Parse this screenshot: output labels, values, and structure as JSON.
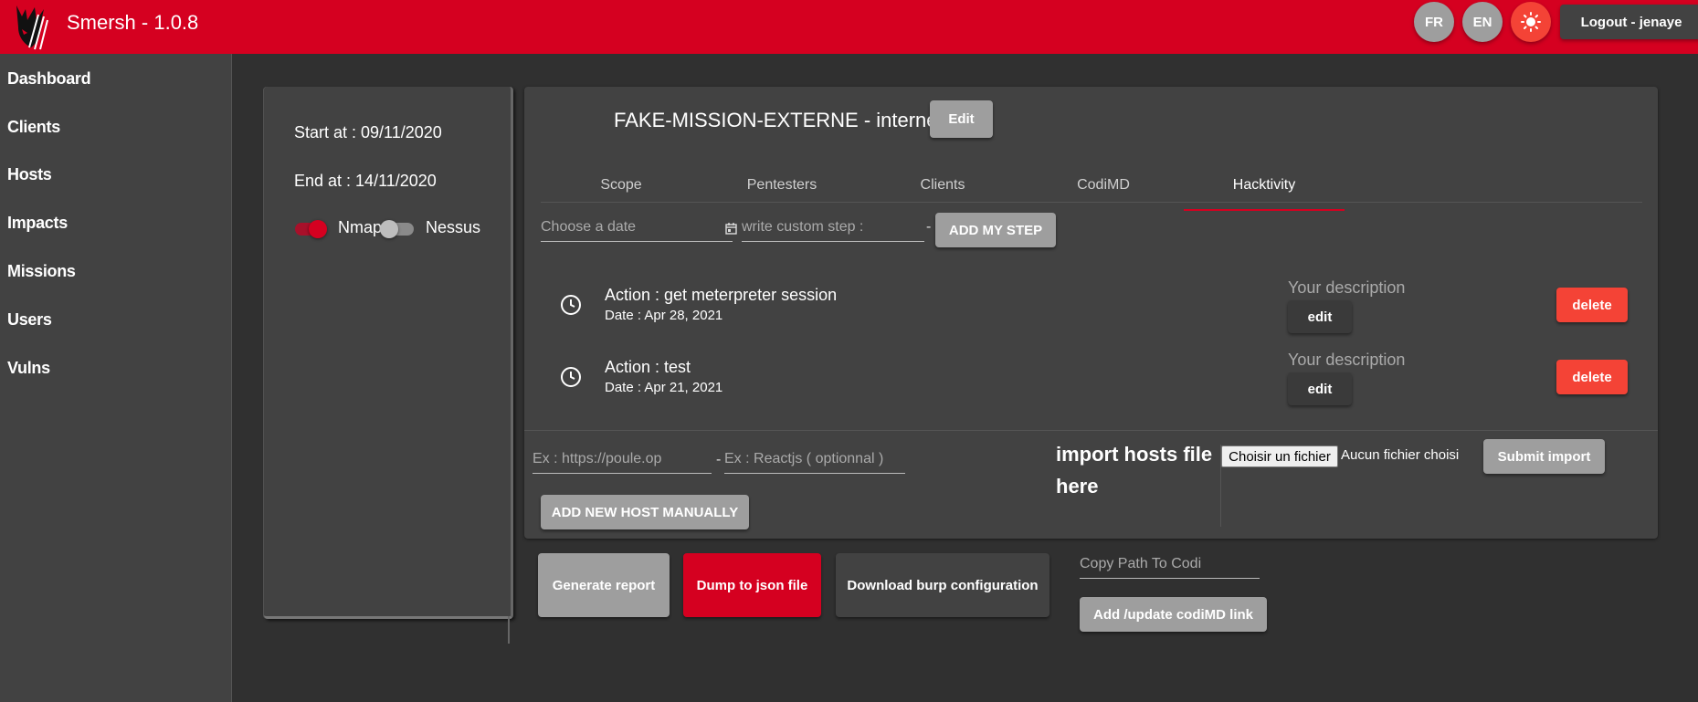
{
  "header": {
    "title": "Smersh - 1.0.8",
    "lang_fr": "FR",
    "lang_en": "EN",
    "theme_icon": "sun-icon",
    "logout_label": "Logout - jenaye"
  },
  "sidebar": {
    "items": [
      {
        "label": "Dashboard"
      },
      {
        "label": "Clients"
      },
      {
        "label": "Hosts"
      },
      {
        "label": "Impacts"
      },
      {
        "label": "Missions"
      },
      {
        "label": "Users"
      },
      {
        "label": "Vulns"
      }
    ]
  },
  "info": {
    "start": "Start at : 09/11/2020",
    "end": "End at : 14/11/2020",
    "nmap_label": "Nmap",
    "nessus_label": "Nessus",
    "nmap_on": true,
    "nessus_on": false
  },
  "mission": {
    "title": "FAKE-MISSION-EXTERNE - interne",
    "edit_label": "Edit",
    "tabs": [
      {
        "label": "Scope"
      },
      {
        "label": "Pentesters"
      },
      {
        "label": "Clients"
      },
      {
        "label": "CodiMD"
      },
      {
        "label": "Hacktivity"
      }
    ],
    "active_tab": "Hacktivity"
  },
  "step_form": {
    "date_placeholder": "Choose a date",
    "step_placeholder": "write custom step :",
    "separator": "-",
    "add_label": "ADD MY STEP"
  },
  "actions": [
    {
      "title": "Action : get meterpreter session",
      "date": "Date : Apr 28, 2021",
      "description": "Your description",
      "edit_label": "edit",
      "delete_label": "delete"
    },
    {
      "title": "Action : test",
      "date": "Date : Apr 21, 2021",
      "description": "Your description",
      "edit_label": "edit",
      "delete_label": "delete"
    }
  ],
  "host_form": {
    "url_placeholder": "Ex : https://poule.op",
    "separator": "-",
    "tech_placeholder": "Ex : Reactjs ( optionnal )",
    "add_label": "ADD NEW HOST MANUALLY",
    "import_label": "import hosts file here",
    "file_button": "Choisir un fichier",
    "file_status": "Aucun fichier choisi",
    "submit_label": "Submit import"
  },
  "footer_actions": {
    "report_label": "Generate report",
    "dump_label": "Dump to json file",
    "burp_label": "Download burp configuration",
    "codi_placeholder": "Copy Path To Codi",
    "codi_label": "Add /update codiMD link"
  },
  "colors": {
    "brand_red": "#d50020",
    "danger": "#f44336",
    "background": "#303030",
    "surface": "#424242"
  }
}
